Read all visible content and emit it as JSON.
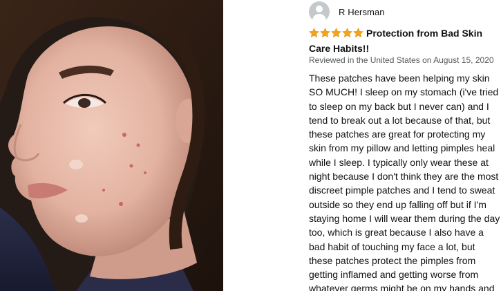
{
  "photo": {
    "icon": "review-photo"
  },
  "reviewer": {
    "name": "R Hersman",
    "avatar_icon": "user-avatar-icon"
  },
  "rating": {
    "stars": 5,
    "max": 5,
    "color": "#f4a41c"
  },
  "review": {
    "title": "Protection from Bad Skin Care Habits!!",
    "meta": "Reviewed in the United States on August 15, 2020",
    "body": "These patches have been helping my skin SO MUCH! I sleep on my stomach (i've tried to sleep on my back but I never can) and I tend to break out a lot because of that, but these patches are great for protecting my skin from my pillow and letting pimples heal while I sleep. I typically only wear these at night because I don't think they are the most discreet pimple patches and I tend to sweat outside so they end up falling off but if I'm staying home I will wear them during the day too, which is great because I also have a bad habit of touching my face a lot, but these patches protect the pimples from getting inflamed and getting worse from whatever germs might be on my hands and"
  }
}
